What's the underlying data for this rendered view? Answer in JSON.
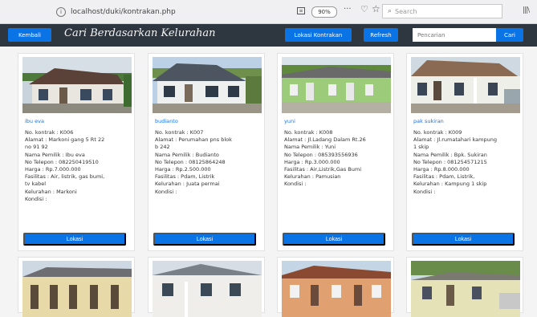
{
  "browser": {
    "url": "localhost/duki/kontrakan.php",
    "zoom": "90%",
    "search_placeholder": "Search"
  },
  "navbar": {
    "back_label": "Kembali",
    "title": "Cari Berdasarkan Kelurahan",
    "kontrakan_label": "Lokasi Kontrakan",
    "refresh_label": "Refresh",
    "search_placeholder": "Pencarian",
    "search_button": "Cari"
  },
  "cards": [
    {
      "name": "ibu eva",
      "details": [
        "No. kontrak : K006",
        "Alamat : Markoni gang 5 Rt 22",
        "no 91 92",
        "Nama Pemilik : Ibu eva",
        "No Telepon : 082250419510",
        "Harga : Rp.7.000.000",
        "Fasilitas : Air, listrik, gas bumi,",
        "tv kabel",
        "Kelurahan : Markoni",
        "Kondisi :"
      ],
      "button": "Lokasi"
    },
    {
      "name": "budianto",
      "details": [
        "No. kontrak : K007",
        "Alamat : Perumahan pns blok",
        "b 242",
        "Nama Pemilik : Budianto",
        "No Telepon : 08125864248",
        "Harga : Rp.2.500.000",
        "Fasilitas : Pdam, Listrik",
        "Kelurahan : Juata permai",
        "Kondisi :"
      ],
      "button": "Lokasi"
    },
    {
      "name": "yuni",
      "details": [
        "No. kontrak : K008",
        "Alamat : Jl.Ladang Dalam Rt.26",
        "Nama Pemilik : Yuni",
        "No Telepon : 085393556936",
        "Harga : Rp.3.000.000",
        "Fasilitas : Air,Listrik,Gas Bumi",
        "Kelurahan : Pamusian",
        "Kondisi :"
      ],
      "button": "Lokasi"
    },
    {
      "name": "pak sukiran",
      "details": [
        "No. kontrak : K009",
        "Alamat : Jl.rumatahari kampung",
        "1 skip",
        "Nama Pemilik : Bpk. Sukiran",
        "No Telepon : 081254571215",
        "Harga : Rp.8.000.000",
        "Fasilitas : Pdam, Listrik,",
        "Kelurahan : Kampung 1 skip",
        "Kondisi :"
      ],
      "button": "Lokasi"
    }
  ],
  "colors": {
    "navbar_bg": "#2e3640",
    "button_blue": "#0a73e6",
    "link_blue": "#1a73e8"
  }
}
